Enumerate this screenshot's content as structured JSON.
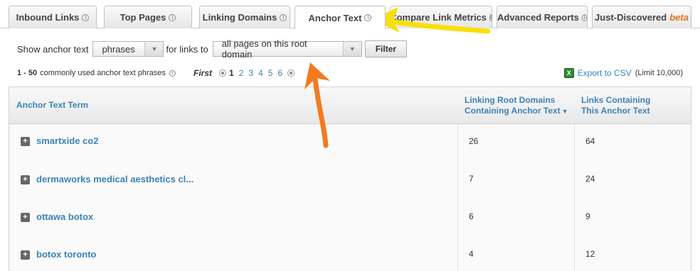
{
  "tabs": [
    {
      "label": "Inbound Links",
      "info": true,
      "active": false
    },
    {
      "label": "Top Pages",
      "info": true,
      "active": false
    },
    {
      "label": "Linking Domains",
      "info": true,
      "active": false
    },
    {
      "label": "Anchor Text",
      "info": true,
      "active": true
    },
    {
      "label": "Compare Link Metrics",
      "info": true,
      "active": false
    },
    {
      "label": "Advanced Reports",
      "info": true,
      "active": false
    },
    {
      "label": "Just-Discovered",
      "info": false,
      "badge": "beta",
      "active": false
    }
  ],
  "filter": {
    "show_label": "Show anchor text",
    "type_value": "phrases",
    "for_links_label": "for links to",
    "target_value": "all pages on this root domain",
    "button_label": "Filter"
  },
  "info": {
    "range": "1 - 50",
    "description": "commonly used anchor text phrases"
  },
  "pagination": {
    "first_label": "First",
    "pages": [
      "1",
      "2",
      "3",
      "4",
      "5",
      "6"
    ],
    "current": "1"
  },
  "export": {
    "icon": "excel-icon",
    "label": "Export to CSV",
    "limit": "(Limit 10,000)"
  },
  "table": {
    "headers": {
      "term": "Anchor Text Term",
      "domains_line1": "Linking Root Domains",
      "domains_line2": "Containing Anchor Text",
      "links_line1": "Links Containing",
      "links_line2": "This Anchor Text"
    },
    "rows": [
      {
        "term": "smartxide co2",
        "domains": "26",
        "links": "64"
      },
      {
        "term": "dermaworks medical aesthetics cl...",
        "domains": "7",
        "links": "24"
      },
      {
        "term": "ottawa botox",
        "domains": "6",
        "links": "9"
      },
      {
        "term": "botox toronto",
        "domains": "4",
        "links": "12"
      }
    ]
  },
  "colors": {
    "link": "#3a83b9",
    "annotation_yellow": "#f7e00a",
    "annotation_orange": "#f47a1f"
  }
}
